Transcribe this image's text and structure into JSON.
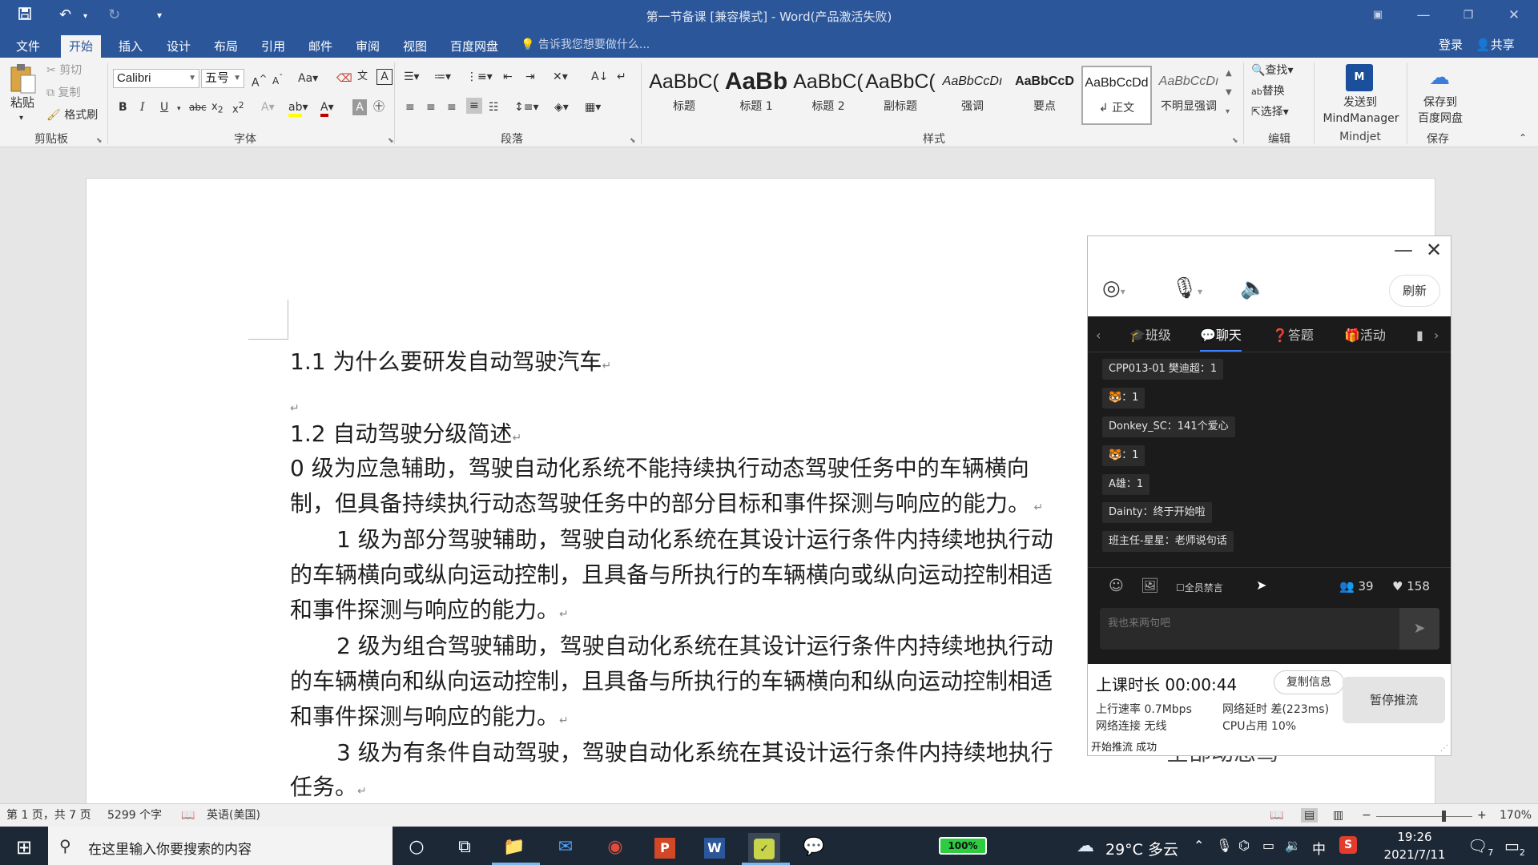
{
  "window": {
    "title": "第一节备课 [兼容模式] - Word(产品激活失败)",
    "signin": "登录",
    "share": "共享"
  },
  "ribbon_tabs": [
    "文件",
    "开始",
    "插入",
    "设计",
    "布局",
    "引用",
    "邮件",
    "审阅",
    "视图",
    "百度网盘"
  ],
  "active_tab": "开始",
  "tell_me": "告诉我您想要做什么...",
  "clipboard": {
    "paste": "粘贴",
    "cut": "剪切",
    "copy": "复制",
    "format_painter": "格式刷",
    "group": "剪贴板"
  },
  "font": {
    "name": "Calibri",
    "size": "五号",
    "group": "字体"
  },
  "paragraph": {
    "group": "段落"
  },
  "styles": {
    "group": "样式",
    "items": [
      {
        "sample": "AaBbC(",
        "label": "标题"
      },
      {
        "sample": "AaBb",
        "label": "标题 1"
      },
      {
        "sample": "AaBbC(",
        "label": "标题 2"
      },
      {
        "sample": "AaBbC(",
        "label": "副标题"
      },
      {
        "sample": "AaBbCcDı",
        "label": "强调"
      },
      {
        "sample": "AaBbCcD",
        "label": "要点"
      },
      {
        "sample": "AaBbCcDd",
        "label": "正文"
      },
      {
        "sample": "AaBbCcDı",
        "label": "不明显强调"
      }
    ],
    "selected": "正文"
  },
  "editing": {
    "find": "查找",
    "replace": "替换",
    "select": "选择",
    "group": "编辑"
  },
  "mindjet": {
    "send": "发送到",
    "target": "MindManager",
    "group": "Mindjet"
  },
  "save_group": {
    "label1": "保存到",
    "label2": "百度网盘",
    "group": "保存"
  },
  "document": {
    "h1": "1.1 为什么要研发自动驾驶汽车",
    "h2": "1.2 自动驾驶分级简述",
    "p0_l1": "0 级为应急辅助，驾驶自动化系统不能持续执行动态驾驶任务中的车辆横向",
    "p0_l2": "制，但具备持续执行动态驾驶任务中的部分目标和事件探测与响应的能力。",
    "p1_l1": "1 级为部分驾驶辅助，驾驶自动化系统在其设计运行条件内持续地执行动",
    "p1_l2": "的车辆横向或纵向运动控制，且具备与所执行的车辆横向或纵向运动控制相适",
    "p1_l3": "和事件探测与响应的能力。",
    "p2_l1": "2 级为组合驾驶辅助，驾驶自动化系统在其设计运行条件内持续地执行动",
    "p2_l2": "的车辆横向和纵向运动控制，且具备与所执行的车辆横向和纵向运动控制相适",
    "p2_l3": "和事件探测与响应的能力。",
    "p3_l1": "3 级为有条件自动驾驶，驾驶自动化系统在其设计运行条件内持续地执行",
    "p3_l2": "任务。",
    "overlay_tail": "全部动态驾"
  },
  "chat_panel": {
    "refresh": "刷新",
    "tabs": [
      "班级",
      "聊天",
      "答题",
      "活动"
    ],
    "active_tab": "聊天",
    "messages": [
      "CPP013-01 樊迪超：1",
      "🐯：1",
      "Donkey_SC：141个爱心",
      "🐯：1",
      "A雄：1",
      "Dainty：终于开始啦",
      "班主任-星星：老师说句话"
    ],
    "mute_all": "全员禁言",
    "viewers": "39",
    "likes": "158",
    "input_placeholder": "我也来两句吧",
    "duration_label": "上课时长",
    "duration": "00:00:44",
    "copy_info": "复制信息",
    "pause_push": "暂停推流",
    "upload_rate_label": "上行速率",
    "upload_rate": "0.7Mbps",
    "latency_label": "网络延时",
    "latency": "差(223ms)",
    "network_label": "网络连接",
    "network": "无线",
    "cpu_label": "CPU占用",
    "cpu": "10%",
    "push_status": "开始推流 成功"
  },
  "statusbar": {
    "page": "第 1 页，共 7 页",
    "words": "5299 个字",
    "language": "英语(美国)",
    "zoom": "170%",
    "zoom_level": 0.7
  },
  "taskbar": {
    "search_placeholder": "在这里输入你要搜索的内容",
    "battery": "100%",
    "weather": "29°C 多云",
    "ime": "中",
    "time": "19:26",
    "date": "2021/7/11",
    "notifications": "7",
    "desktop_count": "2"
  },
  "colors": {
    "word_blue": "#2b579a",
    "taskbar": "#1d2836",
    "chat_dark": "#1b1b1b",
    "font_color_red": "#c00000",
    "highlight_yellow": "#ffff00"
  }
}
